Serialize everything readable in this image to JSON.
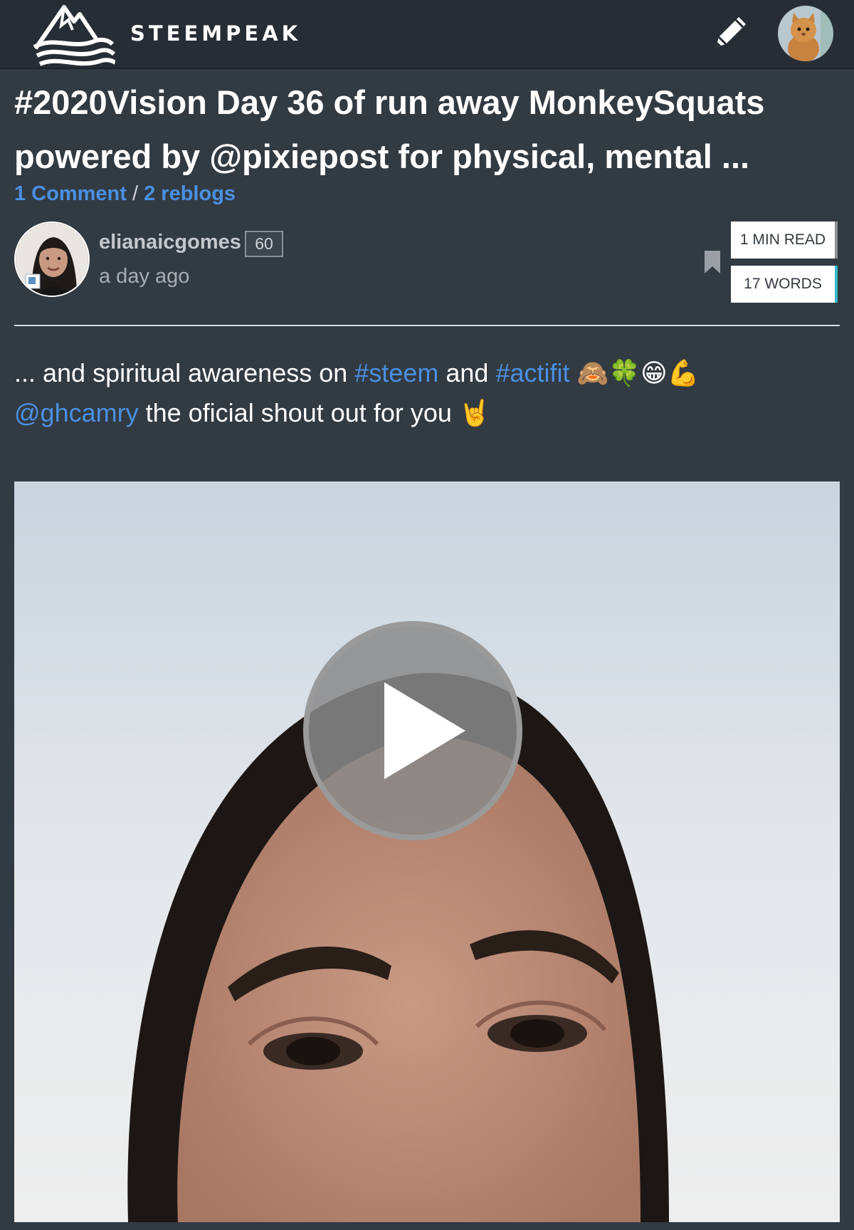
{
  "header": {
    "brand": "STEEMPEAK",
    "logo_icon": "mountain-wave-logo",
    "write_icon": "pencil-icon",
    "user_avatar_icon": "cat-avatar"
  },
  "post": {
    "title": "#2020Vision Day 36 of run away MonkeySquats powered by @pixiepost for physical, mental ...",
    "comments_label": "1 Comment",
    "separator": "/",
    "reblogs_label": "2 reblogs",
    "author": "elianaicgomes",
    "reputation": "60",
    "time_ago": "a day ago",
    "read_time": "1 MIN READ",
    "word_count": "17 WORDS",
    "body": {
      "part1": "... and spiritual awareness on",
      "tag1": "#steem",
      "part2": "and",
      "tag2": "#actifit",
      "emojis1": "🙈🍀😁💪",
      "mention": "@ghcamry",
      "part3": "the oficial shout out for you",
      "emojis2": "🤘"
    }
  },
  "colors": {
    "background": "#323a42",
    "header_bg": "#262d34",
    "link": "#4a90e2",
    "words_accent": "#36b8c8"
  }
}
